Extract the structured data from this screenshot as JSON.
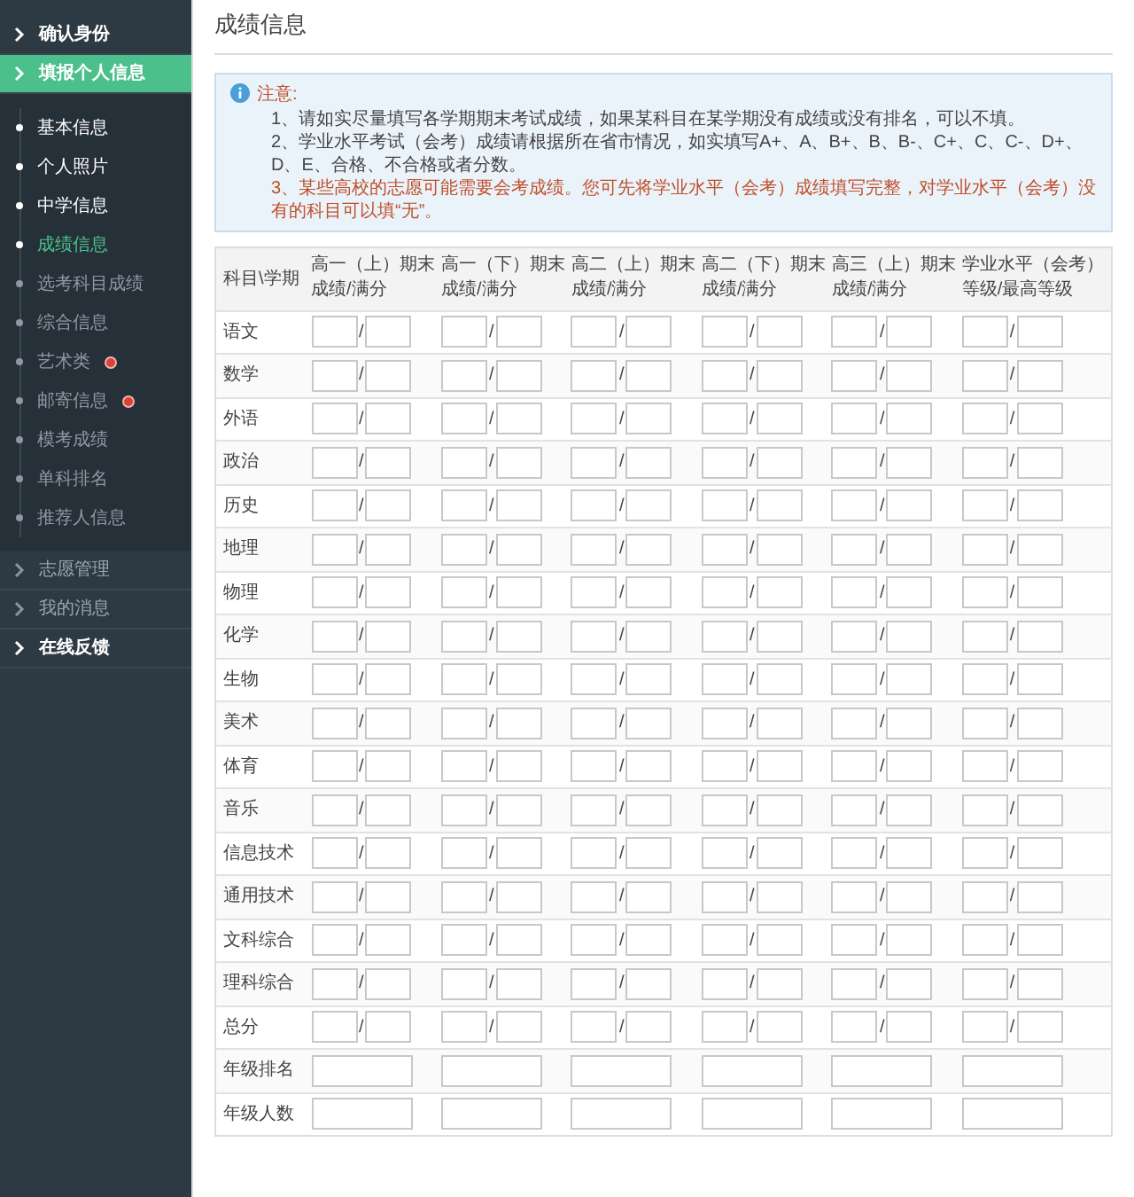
{
  "sidebar": {
    "items": [
      {
        "label": "确认身份",
        "selected": false,
        "enabled": true
      },
      {
        "label": "填报个人信息",
        "selected": true,
        "enabled": true,
        "children": [
          {
            "label": "基本信息",
            "selected": false,
            "done": true,
            "alert": false
          },
          {
            "label": "个人照片",
            "selected": false,
            "done": true,
            "alert": false
          },
          {
            "label": "中学信息",
            "selected": false,
            "done": true,
            "alert": false
          },
          {
            "label": "成绩信息",
            "selected": true,
            "done": false,
            "alert": false
          },
          {
            "label": "选考科目成绩",
            "selected": false,
            "done": false,
            "alert": false
          },
          {
            "label": "综合信息",
            "selected": false,
            "done": false,
            "alert": false
          },
          {
            "label": "艺术类",
            "selected": false,
            "done": false,
            "alert": true
          },
          {
            "label": "邮寄信息",
            "selected": false,
            "done": false,
            "alert": true
          },
          {
            "label": "模考成绩",
            "selected": false,
            "done": false,
            "alert": false
          },
          {
            "label": "单科排名",
            "selected": false,
            "done": false,
            "alert": false
          },
          {
            "label": "推荐人信息",
            "selected": false,
            "done": false,
            "alert": false
          }
        ]
      },
      {
        "label": "志愿管理",
        "selected": false,
        "enabled": false
      },
      {
        "label": "我的消息",
        "selected": false,
        "enabled": false
      },
      {
        "label": "在线反馈",
        "selected": false,
        "enabled": true
      }
    ]
  },
  "page": {
    "title": "成绩信息"
  },
  "notice": {
    "heading": "注意:",
    "lines": [
      {
        "text": "1、请如实尽量填写各学期期末考试成绩，如果某科目在某学期没有成绩或没有排名，可以不填。",
        "warning": false
      },
      {
        "text": "2、学业水平考试（会考）成绩请根据所在省市情况，如实填写A+、A、B+、B、B-、C+、C、C-、D+、D、E、合格、不合格或者分数。",
        "warning": false
      },
      {
        "text": "3、某些高校的志愿可能需要会考成绩。您可先将学业水平（会考）成绩填写完整，对学业水平（会考）没有的科目可以填“无”。",
        "warning": true
      }
    ]
  },
  "table": {
    "corner": "科目\\学期",
    "columns": [
      {
        "title": "高一（上）期末",
        "subtitle": "成绩/满分"
      },
      {
        "title": "高一（下）期末",
        "subtitle": "成绩/满分"
      },
      {
        "title": "高二（上）期末",
        "subtitle": "成绩/满分"
      },
      {
        "title": "高二（下）期末",
        "subtitle": "成绩/满分"
      },
      {
        "title": "高三（上）期末",
        "subtitle": "成绩/满分"
      },
      {
        "title": "学业水平（会考）",
        "subtitle": "等级/最高等级"
      }
    ],
    "separator": "/",
    "rows": [
      {
        "subject": "语文",
        "kind": "pair"
      },
      {
        "subject": "数学",
        "kind": "pair"
      },
      {
        "subject": "外语",
        "kind": "pair"
      },
      {
        "subject": "政治",
        "kind": "pair"
      },
      {
        "subject": "历史",
        "kind": "pair"
      },
      {
        "subject": "地理",
        "kind": "pair"
      },
      {
        "subject": "物理",
        "kind": "pair"
      },
      {
        "subject": "化学",
        "kind": "pair"
      },
      {
        "subject": "生物",
        "kind": "pair"
      },
      {
        "subject": "美术",
        "kind": "pair"
      },
      {
        "subject": "体育",
        "kind": "pair"
      },
      {
        "subject": "音乐",
        "kind": "pair"
      },
      {
        "subject": "信息技术",
        "kind": "pair"
      },
      {
        "subject": "通用技术",
        "kind": "pair"
      },
      {
        "subject": "文科综合",
        "kind": "pair"
      },
      {
        "subject": "理科综合",
        "kind": "pair"
      },
      {
        "subject": "总分",
        "kind": "pair"
      },
      {
        "subject": "年级排名",
        "kind": "single"
      },
      {
        "subject": "年级人数",
        "kind": "single"
      }
    ]
  }
}
